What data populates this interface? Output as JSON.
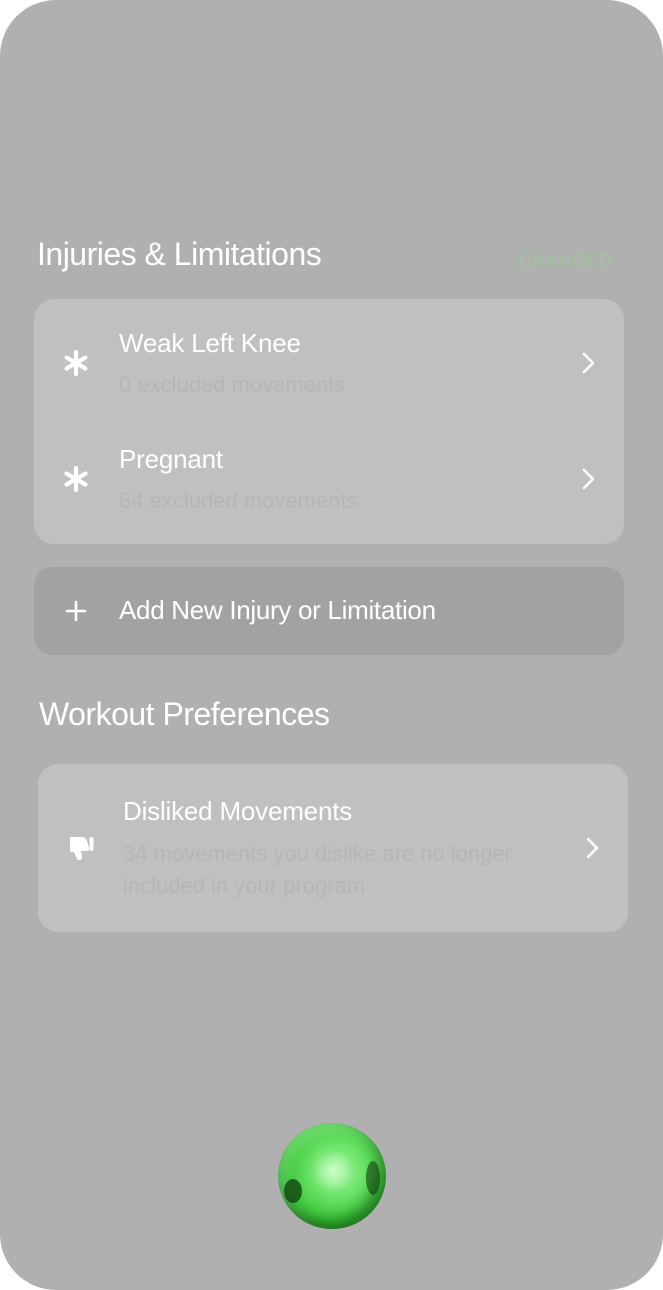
{
  "injuries": {
    "title": "Injuries & Limitations",
    "changed_tag": "CHANGED",
    "items": [
      {
        "name": "Weak Left Knee",
        "detail": "0 excluded movements",
        "icon": "asterisk-icon"
      },
      {
        "name": "Pregnant",
        "detail": "84 excluded movements",
        "icon": "asterisk-icon"
      }
    ],
    "add_label": "Add New Injury or Limitation"
  },
  "preferences": {
    "title": "Workout Preferences",
    "items": [
      {
        "name": "Disliked Movements",
        "detail": "34 movements you dislike are no longer included in your program",
        "icon": "thumbs-down-icon"
      }
    ]
  },
  "colors": {
    "background": "#b0b0b0",
    "card": "#c0c0c0",
    "add_button": "#a2a2a2",
    "changed_tag": "#9cc79a",
    "orb": "#6fe46c"
  }
}
